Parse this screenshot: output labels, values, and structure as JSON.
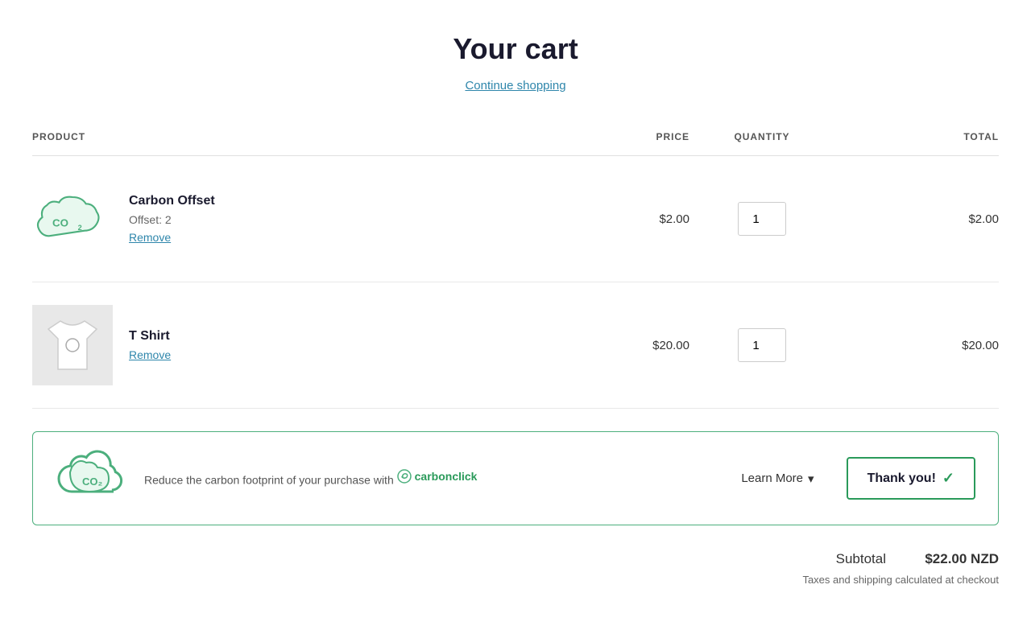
{
  "page": {
    "title": "Your cart",
    "continue_shopping_label": "Continue shopping"
  },
  "table": {
    "headers": {
      "product": "PRODUCT",
      "price": "PRICE",
      "quantity": "QUANTITY",
      "total": "TOTAL"
    },
    "rows": [
      {
        "id": "carbon-offset",
        "name": "Carbon Offset",
        "meta": "Offset: 2",
        "remove_label": "Remove",
        "price": "$2.00",
        "quantity": 1,
        "total": "$2.00",
        "type": "co2"
      },
      {
        "id": "tshirt",
        "name": "T Shirt",
        "meta": "",
        "remove_label": "Remove",
        "price": "$20.00",
        "quantity": 1,
        "total": "$20.00",
        "type": "image"
      }
    ]
  },
  "carbonclick": {
    "description": "Reduce the carbon footprint of your purchase with",
    "brand_name": "carbonclick",
    "learn_more_label": "Learn More",
    "thank_you_label": "Thank you!"
  },
  "summary": {
    "subtotal_label": "Subtotal",
    "subtotal_value": "$22.00 NZD",
    "taxes_note": "Taxes and shipping calculated at checkout"
  }
}
